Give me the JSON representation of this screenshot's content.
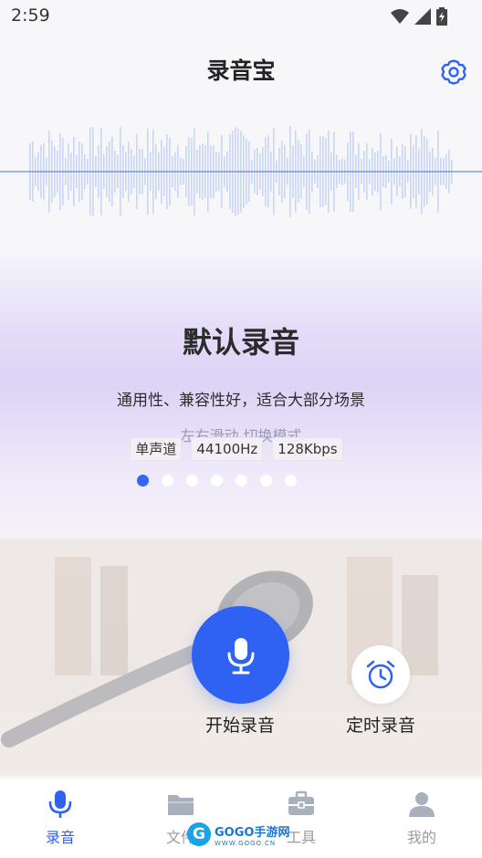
{
  "status_bar": {
    "time": "2:59",
    "icons": [
      "wifi-icon",
      "signal-icon",
      "battery-icon"
    ]
  },
  "header": {
    "title": "录音宝",
    "settings_icon": "gear-icon"
  },
  "mode": {
    "title": "默认录音",
    "description": "通用性、兼容性好，适合大部分场景",
    "swipe_hint": "左右滑动 切换模式",
    "tags": [
      "单声道",
      "44100Hz",
      "128Kbps"
    ],
    "page_count": 7,
    "active_page": 1
  },
  "actions": {
    "record_label": "开始录音",
    "record_icon": "microphone-icon",
    "timer_label": "定时录音",
    "timer_icon": "alarm-clock-icon"
  },
  "tabs": [
    {
      "label": "录音",
      "icon": "microphone-icon",
      "active": true
    },
    {
      "label": "文件",
      "icon": "folder-icon",
      "active": false
    },
    {
      "label": "工具",
      "icon": "toolbox-icon",
      "active": false
    },
    {
      "label": "我的",
      "icon": "user-icon",
      "active": false
    }
  ],
  "watermark": {
    "text": "GOGO手游网",
    "sub": "WWW.GOGO.CN"
  },
  "colors": {
    "accent": "#2f62f3",
    "waveform": "#c9d6f6",
    "inactive_tab": "#9b9b9b"
  }
}
